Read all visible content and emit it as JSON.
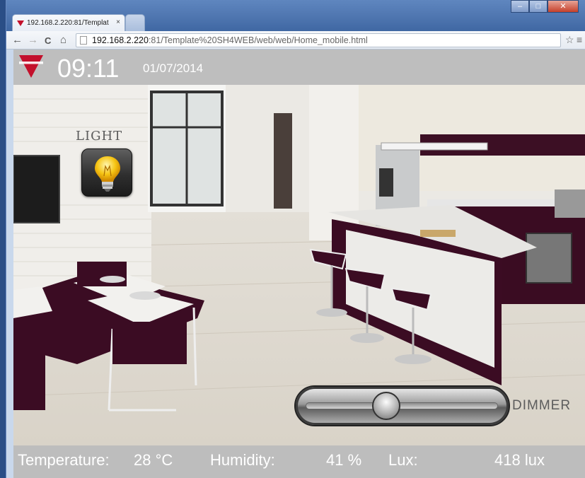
{
  "browser": {
    "tab_title": "192.168.2.220:81/Templat",
    "tab_close": "×",
    "url_host": "192.168.2.220",
    "url_path": ":81/Template%20SH4WEB/web/web/Home_mobile.html",
    "nav": {
      "back": "←",
      "forward": "→",
      "reload": "C",
      "home": "⌂"
    },
    "window_buttons": {
      "minimize": "–",
      "maximize": "□",
      "close": "✕"
    },
    "toolbar_right": {
      "star": "☆",
      "menu": "≡"
    }
  },
  "header": {
    "logo": "CARLO GAVAZZI",
    "time": "09:11",
    "date": "01/07/2014"
  },
  "scene": {
    "light_label": "LIGHT",
    "light_icon": "lightbulb-icon",
    "dimmer_label": "DIMMER",
    "dimmer_level": 0.42
  },
  "footer": {
    "temperature_label": "Temperature:",
    "temperature_value": "28 °C",
    "humidity_label": "Humidity:",
    "humidity_value": "41 %",
    "lux_label": "Lux:",
    "lux_value": "418 lux"
  },
  "colors": {
    "brand_red": "#c3102b",
    "header_gray": "#bebebe",
    "text_white": "#ffffff"
  }
}
